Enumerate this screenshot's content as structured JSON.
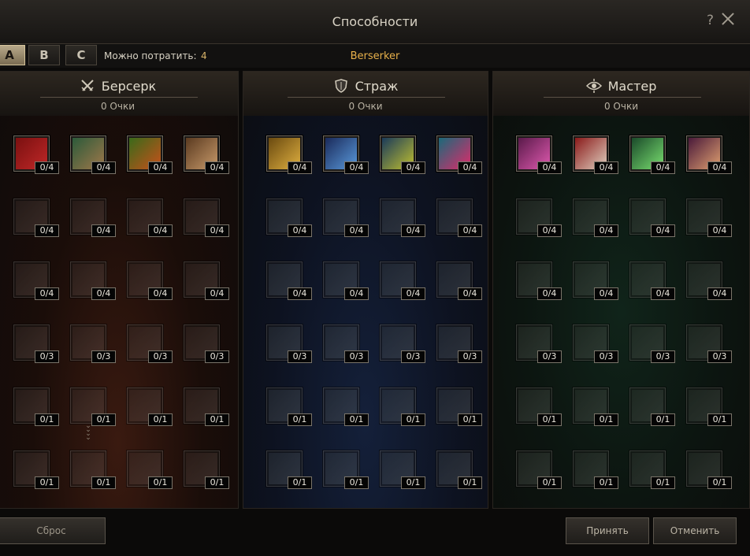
{
  "window": {
    "title": "Способности"
  },
  "presets": [
    {
      "label": "A",
      "active": true
    },
    {
      "label": "B",
      "active": false
    },
    {
      "label": "C",
      "active": false
    }
  ],
  "points": {
    "label": "Можно потратить:",
    "value": "4"
  },
  "class_name": "Berserker",
  "panels": [
    {
      "name": "Берсерк",
      "points": "0 Очки",
      "icon": "crossed-swords-icon",
      "skills": [
        [
          "0/4",
          "0/4",
          "0/4",
          "0/4"
        ],
        [
          "0/4",
          "0/4",
          "0/4",
          "0/4"
        ],
        [
          "0/4",
          "0/4",
          "0/4",
          "0/4"
        ],
        [
          "0/3",
          "0/3",
          "0/3",
          "0/3"
        ],
        [
          "0/1",
          "0/1",
          "0/1",
          "0/1"
        ],
        [
          "0/1",
          "0/1",
          "0/1",
          "0/1"
        ]
      ]
    },
    {
      "name": "Страж",
      "points": "0 Очки",
      "icon": "shield-icon",
      "skills": [
        [
          "0/4",
          "0/4",
          "0/4",
          "0/4"
        ],
        [
          "0/4",
          "0/4",
          "0/4",
          "0/4"
        ],
        [
          "0/4",
          "0/4",
          "0/4",
          "0/4"
        ],
        [
          "0/3",
          "0/3",
          "0/3",
          "0/3"
        ],
        [
          "0/1",
          "0/1",
          "0/1",
          "0/1"
        ],
        [
          "0/1",
          "0/1",
          "0/1",
          "0/1"
        ]
      ]
    },
    {
      "name": "Мастер",
      "points": "0 Очки",
      "icon": "eye-icon",
      "skills": [
        [
          "0/4",
          "0/4",
          "0/4",
          "0/4"
        ],
        [
          "0/4",
          "0/4",
          "0/4",
          "0/4"
        ],
        [
          "0/4",
          "0/4",
          "0/4",
          "0/4"
        ],
        [
          "0/3",
          "0/3",
          "0/3",
          "0/3"
        ],
        [
          "0/1",
          "0/1",
          "0/1",
          "0/1"
        ],
        [
          "0/1",
          "0/1",
          "0/1",
          "0/1"
        ]
      ]
    }
  ],
  "buttons": {
    "reset": "Сброс",
    "accept": "Принять",
    "cancel": "Отменить"
  },
  "colors": {
    "accent": "#e7b04a",
    "counter_bg": "#050505"
  }
}
